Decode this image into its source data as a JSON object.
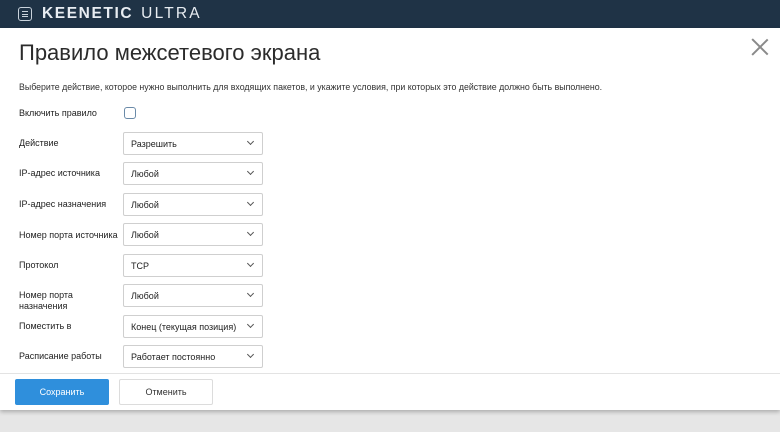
{
  "header": {
    "brand_primary": "KEENETIC",
    "brand_secondary": "ULTRA",
    "menu_icon": "menu-icon"
  },
  "dialog": {
    "title": "Правило межсетевого экрана",
    "description": "Выберите действие, которое нужно выполнить для входящих пакетов, и укажите условия, при которых это действие должно быть выполнено.",
    "close_icon": "close-icon"
  },
  "form": {
    "enable_rule": {
      "label": "Включить правило",
      "checked": false
    },
    "action": {
      "label": "Действие",
      "value": "Разрешить"
    },
    "source_ip": {
      "label": "IP-адрес источника",
      "value": "Любой"
    },
    "dest_ip": {
      "label": "IP-адрес назначения",
      "value": "Любой"
    },
    "source_port": {
      "label": "Номер порта источника",
      "value": "Любой"
    },
    "protocol": {
      "label": "Протокол",
      "value": "TCP"
    },
    "dest_port": {
      "label_line1": "Номер порта",
      "label_line2": "назначения",
      "value": "Любой"
    },
    "place_in": {
      "label": "Поместить в",
      "value": "Конец (текущая позиция)"
    },
    "schedule": {
      "label": "Расписание работы",
      "value": "Работает постоянно"
    }
  },
  "footer": {
    "save_label": "Сохранить",
    "cancel_label": "Отменить"
  },
  "colors": {
    "topbar": "#1f3346",
    "accent": "#2f8fdc"
  }
}
